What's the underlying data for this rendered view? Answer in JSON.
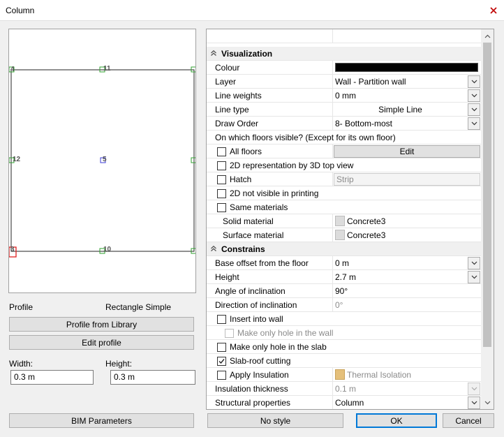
{
  "window": {
    "title": "Column"
  },
  "preview": {
    "labels": [
      {
        "id": "4",
        "text": "4"
      },
      {
        "id": "11",
        "text": "11"
      },
      {
        "id": "12",
        "text": "12"
      },
      {
        "id": "5",
        "text": "5"
      },
      {
        "id": "3",
        "text": "3"
      },
      {
        "id": "10",
        "text": "10"
      }
    ]
  },
  "left": {
    "profile_label": "Profile",
    "profile_value": "Rectangle Simple",
    "profile_library_button": "Profile from Library",
    "edit_profile_button": "Edit profile",
    "width_label": "Width:",
    "width_value": "0.3 m",
    "height_label": "Height:",
    "height_value": "0.3 m",
    "bim_button": "BIM Parameters"
  },
  "properties": {
    "visualization_title": "Visualization",
    "colour_label": "Colour",
    "colour_value": "#000000",
    "layer_label": "Layer",
    "layer_value": "Wall - Partition wall",
    "line_weights_label": "Line weights",
    "line_weights_value": "0 mm",
    "line_type_label": "Line type",
    "line_type_value": "Simple Line",
    "draw_order_label": "Draw Order",
    "draw_order_value": "8- Bottom-most",
    "floors_visible_label": "On which floors visible? (Except for its own floor)",
    "all_floors_label": "All floors",
    "edit_button": "Edit",
    "repr_2d_label": "2D representation by 3D top view",
    "hatch_label": "Hatch",
    "hatch_value": "Strip",
    "not_visible_printing_label": "2D not visible in printing",
    "same_materials_label": "Same materials",
    "solid_material_label": "Solid material",
    "solid_material_value": "Concrete3",
    "surface_material_label": "Surface material",
    "surface_material_value": "Concrete3",
    "constrains_title": "Constrains",
    "base_offset_label": "Base offset from the floor",
    "base_offset_value": "0 m",
    "height_label": "Height",
    "height_value": "2.7 m",
    "angle_label": "Angle of inclination",
    "angle_value": "90°",
    "direction_label": "Direction of inclination",
    "direction_value": "0°",
    "insert_wall_label": "Insert into wall",
    "only_hole_wall_label": "Make only hole in the wall",
    "only_hole_slab_label": "Make only hole in the slab",
    "slab_roof_label": "Slab-roof cutting",
    "apply_insulation_label": "Apply Insulation",
    "insulation_material_value": "Thermal Isolation",
    "insulation_thickness_label": "Insulation thickness",
    "insulation_thickness_value": "0.1 m",
    "structural_label": "Structural properties",
    "structural_value": "Column"
  },
  "buttons": {
    "no_style": "No style",
    "ok": "OK",
    "cancel": "Cancel"
  },
  "colors": {
    "node_green": "#2fa12f",
    "node_blue": "#3b3bd6",
    "node_red": "#e02020",
    "accent": "#0078d7"
  }
}
